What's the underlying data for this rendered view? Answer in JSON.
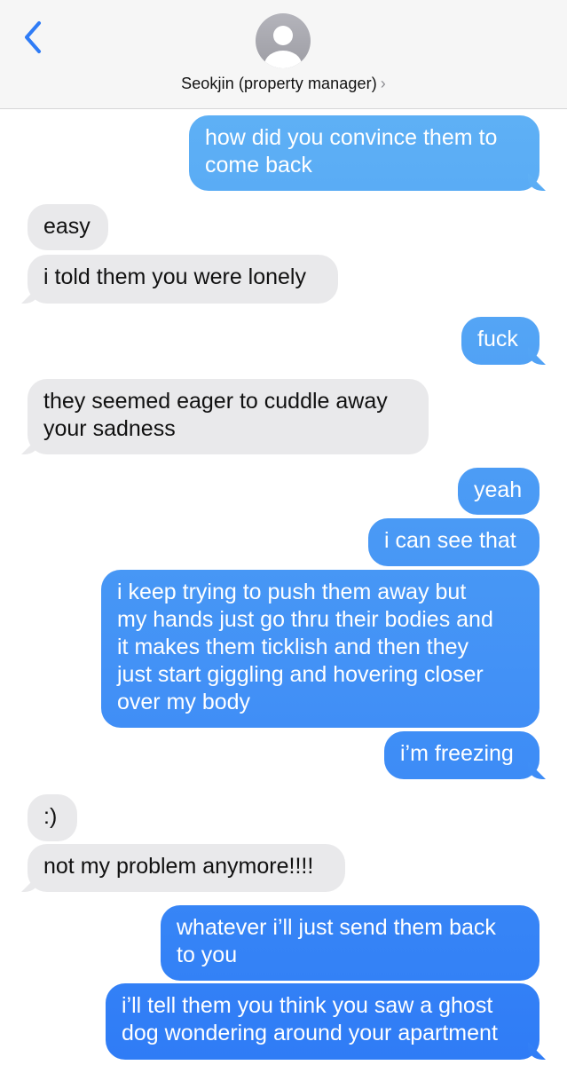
{
  "header": {
    "contact_name": "Seokjin (property manager)",
    "chevron": "›",
    "back_icon": "chevron-left-icon",
    "avatar_icon": "person-silhouette-icon"
  },
  "colors": {
    "sent_top": "#5eb0f5",
    "sent_bottom": "#2f7cf6",
    "received": "#e9e9eb",
    "accent": "#2f7cf6"
  },
  "messages": [
    {
      "from": "me",
      "text": "how did you convince them to\ncome back"
    },
    {
      "from": "them",
      "text": "easy"
    },
    {
      "from": "them",
      "text": "i told them you were lonely"
    },
    {
      "from": "me",
      "text": "fuck"
    },
    {
      "from": "them",
      "text": "they seemed eager to cuddle away\nyour sadness"
    },
    {
      "from": "me",
      "text": "yeah"
    },
    {
      "from": "me",
      "text": "i can see that"
    },
    {
      "from": "me",
      "text": "i keep trying to push them away but\nmy hands just go thru their bodies and\nit makes them ticklish and then they\njust start giggling and hovering closer\nover my body"
    },
    {
      "from": "me",
      "text": "i’m freezing"
    },
    {
      "from": "them",
      "text": ":)"
    },
    {
      "from": "them",
      "text": "not my problem anymore!!!!"
    },
    {
      "from": "me",
      "text": "whatever i’ll just send them back\nto you"
    },
    {
      "from": "me",
      "text": "i’ll tell them you think you saw a ghost\ndog wondering around your apartment"
    }
  ]
}
